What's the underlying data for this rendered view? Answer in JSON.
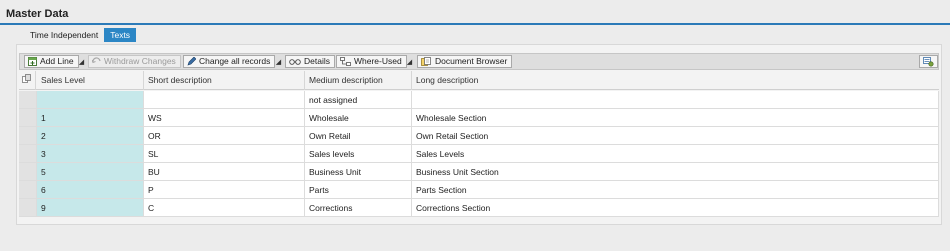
{
  "page": {
    "title": "Master Data"
  },
  "tabs": [
    {
      "label": "Time Independent",
      "active": false
    },
    {
      "label": "Texts",
      "active": true
    }
  ],
  "toolbar": {
    "add_line": "Add Line",
    "withdraw_changes": "Withdraw Changes",
    "change_all_records": "Change all records",
    "details": "Details",
    "where_used": "Where-Used",
    "document_browser": "Document Browser"
  },
  "table": {
    "columns": [
      "Sales Level",
      "Short description",
      "Medium description",
      "Long description"
    ],
    "rows": [
      [
        "",
        "",
        "not assigned",
        ""
      ],
      [
        "1",
        "WS",
        "Wholesale",
        "Wholesale Section"
      ],
      [
        "2",
        "OR",
        "Own Retail",
        "Own Retail Section"
      ],
      [
        "3",
        "SL",
        "Sales levels",
        "Sales Levels"
      ],
      [
        "5",
        "BU",
        "Business Unit",
        "Business Unit Section"
      ],
      [
        "6",
        "P",
        "Parts",
        "Parts Section"
      ],
      [
        "9",
        "C",
        "Corrections",
        "Corrections Section"
      ]
    ]
  },
  "colors": {
    "accent": "#2b86c5",
    "key_column": "#c6e8ea"
  },
  "icons": [
    "add-line-icon",
    "withdraw-icon",
    "pencil-icon",
    "glasses-icon",
    "where-used-icon",
    "document-browser-icon",
    "select-all-icon",
    "settings-icon"
  ]
}
